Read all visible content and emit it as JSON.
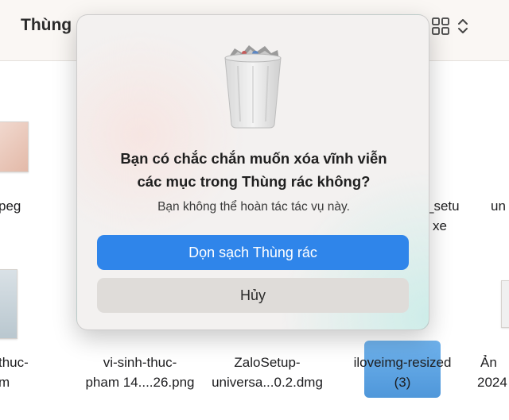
{
  "window": {
    "title": "Thùng"
  },
  "files": {
    "item1_partial": "peg",
    "item2_partial_line1": "_setu",
    "item2_partial_line2": "xe",
    "item3_partial": "un",
    "item4_partial_line1": "thuc-",
    "item4_partial_line2": "m",
    "item5_line1": "vi-sinh-thuc-",
    "item5_line2": "pham 14....26.png",
    "item6_line1": "ZaloSetup-",
    "item6_line2": "universa...0.2.dmg",
    "item7_line1": "iloveimg-resized",
    "item7_line2": "(3)",
    "item8_partial_line1": "Ản",
    "item8_partial_line2": "2024"
  },
  "dialog": {
    "title_line1": "Bạn có chắc chắn muốn xóa vĩnh viễn",
    "title_line2": "các mục trong Thùng rác không?",
    "message": "Bạn không thể hoàn tác tác vụ này.",
    "confirm_label": "Dọn sạch Thùng rác",
    "cancel_label": "Hủy",
    "icon": "trash-icon"
  },
  "colors": {
    "accent": "#2f85ea",
    "cancel_bg": "#dfdcd9"
  }
}
